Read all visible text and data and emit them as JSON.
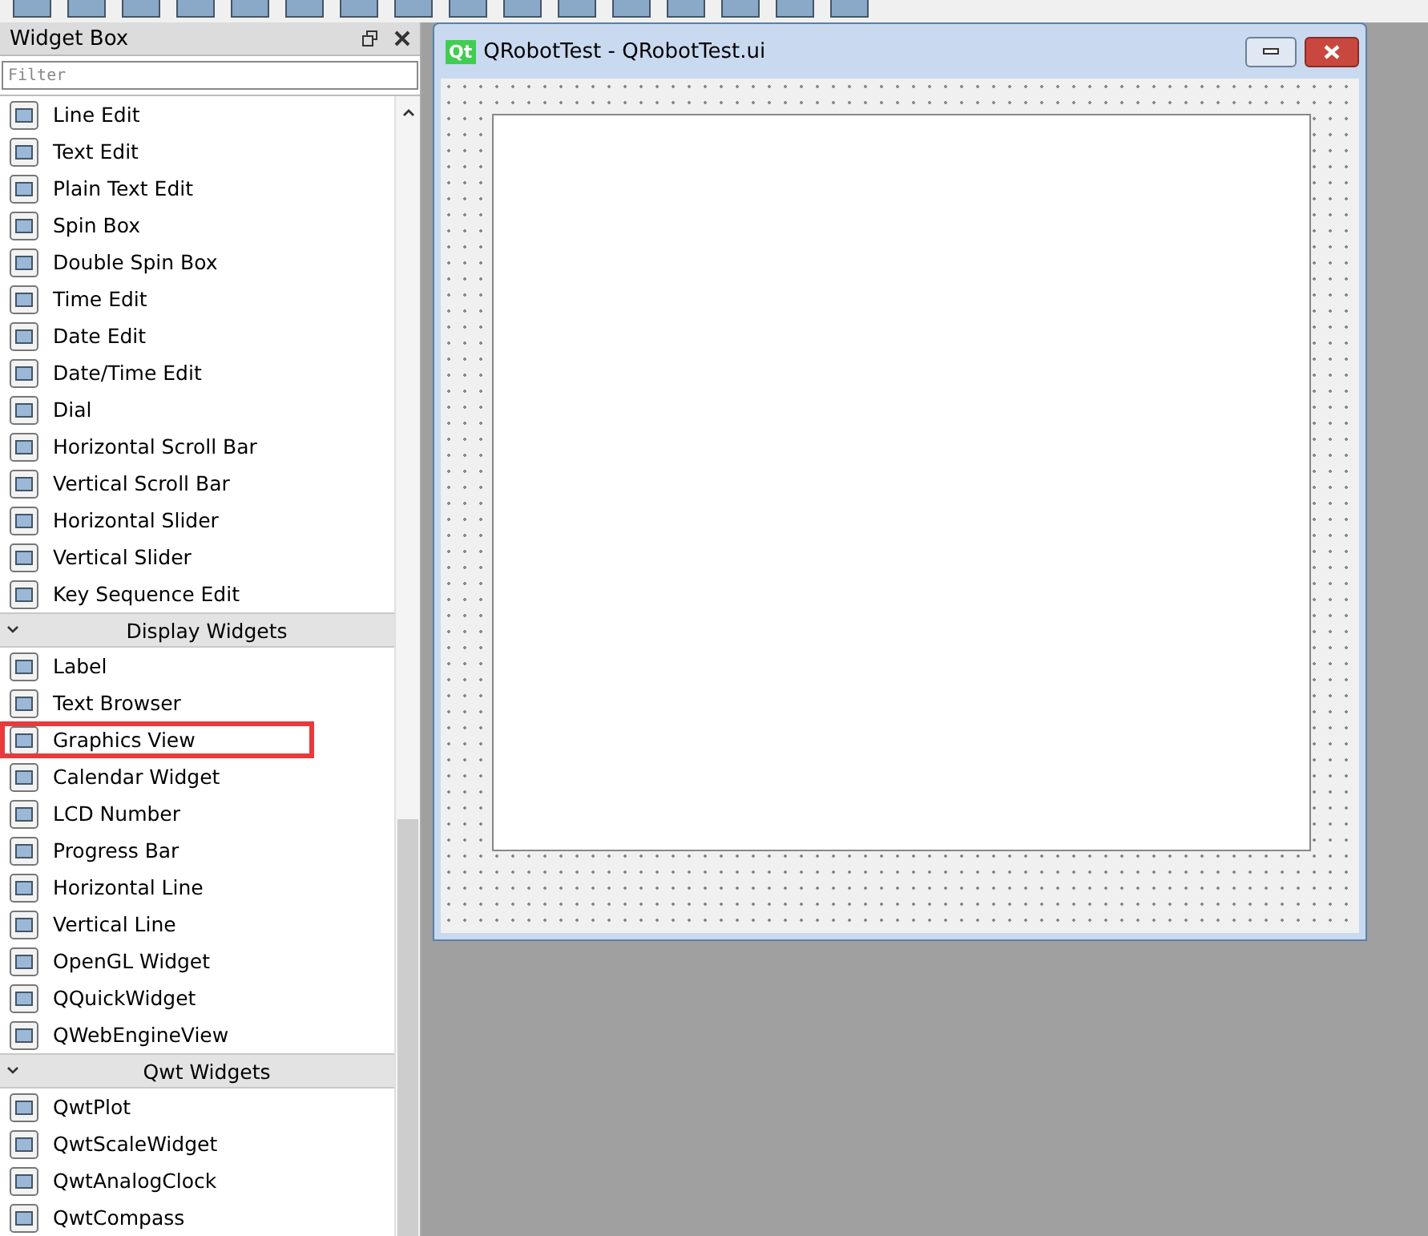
{
  "widget_box": {
    "title": "Widget Box",
    "filter": {
      "placeholder": "Filter"
    },
    "sections": [
      {
        "kind": "items",
        "items": [
          {
            "label": "Line Edit",
            "highlighted": false
          },
          {
            "label": "Text Edit",
            "highlighted": false
          },
          {
            "label": "Plain Text Edit",
            "highlighted": false
          },
          {
            "label": "Spin Box",
            "highlighted": false
          },
          {
            "label": "Double Spin Box",
            "highlighted": false
          },
          {
            "label": "Time Edit",
            "highlighted": false
          },
          {
            "label": "Date Edit",
            "highlighted": false
          },
          {
            "label": "Date/Time Edit",
            "highlighted": false
          },
          {
            "label": "Dial",
            "highlighted": false
          },
          {
            "label": "Horizontal Scroll Bar",
            "highlighted": false
          },
          {
            "label": "Vertical Scroll Bar",
            "highlighted": false
          },
          {
            "label": "Horizontal Slider",
            "highlighted": false
          },
          {
            "label": "Vertical Slider",
            "highlighted": false
          },
          {
            "label": "Key Sequence Edit",
            "highlighted": false
          }
        ]
      },
      {
        "kind": "category",
        "title": "Display Widgets",
        "expanded": true,
        "items": [
          {
            "label": "Label",
            "highlighted": false
          },
          {
            "label": "Text Browser",
            "highlighted": false
          },
          {
            "label": "Graphics View",
            "highlighted": true
          },
          {
            "label": "Calendar Widget",
            "highlighted": false
          },
          {
            "label": "LCD Number",
            "highlighted": false
          },
          {
            "label": "Progress Bar",
            "highlighted": false
          },
          {
            "label": "Horizontal Line",
            "highlighted": false
          },
          {
            "label": "Vertical Line",
            "highlighted": false
          },
          {
            "label": "OpenGL Widget",
            "highlighted": false
          },
          {
            "label": "QQuickWidget",
            "highlighted": false
          },
          {
            "label": "QWebEngineView",
            "highlighted": false
          }
        ]
      },
      {
        "kind": "category",
        "title": "Qwt Widgets",
        "expanded": true,
        "items": [
          {
            "label": "QwtPlot",
            "highlighted": false
          },
          {
            "label": "QwtScaleWidget",
            "highlighted": false
          },
          {
            "label": "QwtAnalogClock",
            "highlighted": false
          },
          {
            "label": "QwtCompass",
            "highlighted": false
          }
        ]
      }
    ]
  },
  "form_window": {
    "logo": "Qt",
    "title": "QRobotTest - QRobotTest.ui"
  }
}
